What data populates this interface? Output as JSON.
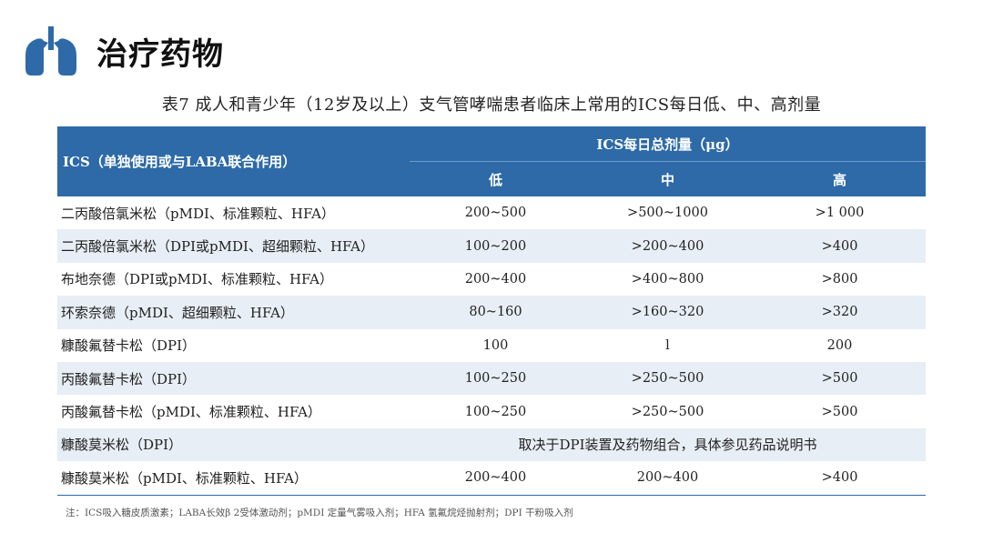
{
  "title": "治疗药物",
  "caption": "表7  成人和青少年（12岁及以上）支气管哮喘患者临床上常用的ICS每日低、中、高剂量",
  "table": {
    "drug_header": "ICS（单独使用或与LABA联合作用）",
    "dose_header": "ICS每日总剂量（μg）",
    "sub_headers": [
      "低",
      "中",
      "高"
    ],
    "rows": [
      {
        "drug": "二丙酸倍氯米松（pMDI、标准颗粒、HFA）",
        "low": "200~500",
        "mid": ">500~1000",
        "high": ">1 000"
      },
      {
        "drug": "二丙酸倍氯米松（DPI或pMDI、超细颗粒、HFA）",
        "low": "100~200",
        "mid": ">200~400",
        "high": ">400"
      },
      {
        "drug": "布地奈德（DPI或pMDI、标准颗粒、HFA）",
        "low": "200~400",
        "mid": ">400~800",
        "high": ">800"
      },
      {
        "drug": "环索奈德（pMDI、超细颗粒、HFA）",
        "low": "80~160",
        "mid": ">160~320",
        "high": ">320"
      },
      {
        "drug": "糠酸氟替卡松（DPI）",
        "low": "100",
        "mid": "l",
        "high": "200"
      },
      {
        "drug": "丙酸氟替卡松（DPI）",
        "low": "100~250",
        "mid": ">250~500",
        "high": ">500"
      },
      {
        "drug": "丙酸氟替卡松（pMDI、标准颗粒、HFA）",
        "low": "100~250",
        "mid": ">250~500",
        "high": ">500"
      },
      {
        "drug": "糠酸莫米松（DPI）",
        "merged": "取决于DPI装置及药物组合，具体参见药品说明书"
      },
      {
        "drug": "糠酸莫米松（pMDI、标准颗粒、HFA）",
        "low": "200~400",
        "mid": "200~400",
        "high": ">400"
      }
    ]
  },
  "footnote": "注：ICS吸入糖皮质激素；LABA长效β 2受体激动剂；pMDI 定量气雾吸入剂；HFA 氢氟烷烃抛射剂；DPI 干粉吸入剂",
  "colors": {
    "header_blue": "#2d6aa7",
    "stripe": "#e8eef5",
    "icon_blue": "#2d6aa7"
  },
  "icons": {
    "logo": "lungs-icon"
  }
}
